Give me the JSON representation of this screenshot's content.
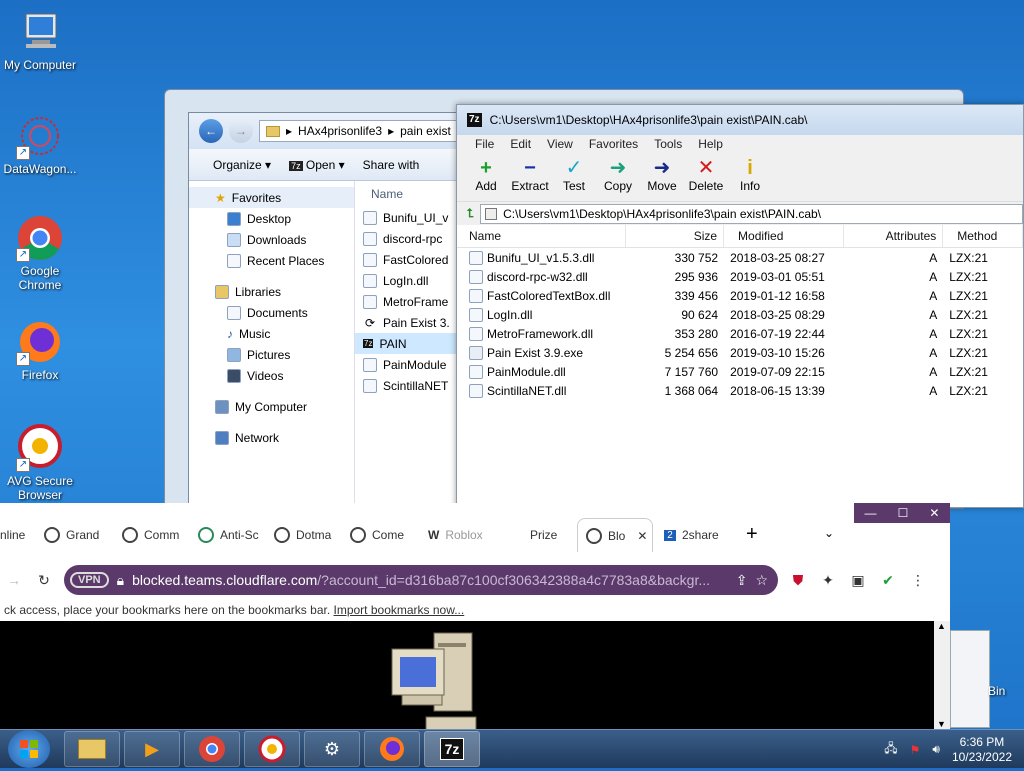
{
  "desktop": {
    "icons": [
      {
        "label": "My Computer",
        "icon": "computer-icon"
      },
      {
        "label": "DataWagon...",
        "icon": "datawagon-icon"
      },
      {
        "label": "Google Chrome",
        "icon": "chrome-icon"
      },
      {
        "label": "Firefox",
        "icon": "firefox-icon"
      },
      {
        "label": "AVG Secure Browser",
        "icon": "avg-browser-icon"
      }
    ],
    "recycle_bin_label": "Bin"
  },
  "explorer": {
    "path": [
      "HAx4prisonlife3",
      "pain exist"
    ],
    "toolbar": {
      "organize": "Organize",
      "open": "Open",
      "share": "Share with"
    },
    "nav": {
      "favorites": "Favorites",
      "favorites_items": [
        "Desktop",
        "Downloads",
        "Recent Places"
      ],
      "libraries": "Libraries",
      "libraries_items": [
        "Documents",
        "Music",
        "Pictures",
        "Videos"
      ],
      "my_computer": "My Computer",
      "network": "Network"
    },
    "column_name": "Name",
    "files": [
      "Bunifu_UI_v",
      "discord-rpc",
      "FastColored",
      "LogIn.dll",
      "MetroFrame",
      "Pain Exist 3.",
      "PAIN",
      "PainModule",
      "ScintillaNET"
    ]
  },
  "sevenzip": {
    "title": "C:\\Users\\vm1\\Desktop\\HAx4prisonlife3\\pain exist\\PAIN.cab\\",
    "logo": "7z",
    "menu": [
      "File",
      "Edit",
      "View",
      "Favorites",
      "Tools",
      "Help"
    ],
    "tools": [
      {
        "label": "Add",
        "glyph": "+",
        "color": "#1e9e2e"
      },
      {
        "label": "Extract",
        "glyph": "−",
        "color": "#1b2fa8"
      },
      {
        "label": "Test",
        "glyph": "✓",
        "color": "#19a6c9"
      },
      {
        "label": "Copy",
        "glyph": "➜",
        "color": "#1aa07a"
      },
      {
        "label": "Move",
        "glyph": "➜",
        "color": "#1a2a8a"
      },
      {
        "label": "Delete",
        "glyph": "✕",
        "color": "#d21a1a"
      },
      {
        "label": "Info",
        "glyph": "i",
        "color": "#d8a800"
      }
    ],
    "address": "C:\\Users\\vm1\\Desktop\\HAx4prisonlife3\\pain exist\\PAIN.cab\\",
    "columns": {
      "name": "Name",
      "size": "Size",
      "modified": "Modified",
      "attributes": "Attributes",
      "method": "Method"
    },
    "rows": [
      {
        "name": "Bunifu_UI_v1.5.3.dll",
        "size": "330 752",
        "modified": "2018-03-25 08:27",
        "attr": "A",
        "method": "LZX:21"
      },
      {
        "name": "discord-rpc-w32.dll",
        "size": "295 936",
        "modified": "2019-03-01 05:51",
        "attr": "A",
        "method": "LZX:21"
      },
      {
        "name": "FastColoredTextBox.dll",
        "size": "339 456",
        "modified": "2019-01-12 16:58",
        "attr": "A",
        "method": "LZX:21"
      },
      {
        "name": "LogIn.dll",
        "size": "90 624",
        "modified": "2018-03-25 08:29",
        "attr": "A",
        "method": "LZX:21"
      },
      {
        "name": "MetroFramework.dll",
        "size": "353 280",
        "modified": "2016-07-19 22:44",
        "attr": "A",
        "method": "LZX:21"
      },
      {
        "name": "Pain Exist 3.9.exe",
        "size": "5 254 656",
        "modified": "2019-03-10 15:26",
        "attr": "A",
        "method": "LZX:21"
      },
      {
        "name": "PainModule.dll",
        "size": "7 157 760",
        "modified": "2019-07-09 22:15",
        "attr": "A",
        "method": "LZX:21"
      },
      {
        "name": "ScintillaNET.dll",
        "size": "1 368 064",
        "modified": "2018-06-15 13:39",
        "attr": "A",
        "method": "LZX:21"
      }
    ]
  },
  "browser": {
    "tabs": [
      "nline",
      "Grand",
      "Comm",
      "Anti-Sc",
      "Dotma",
      "Come",
      "Roblox",
      "Prize",
      "Blo",
      "2share"
    ],
    "url_host": "blocked.teams.cloudflare.com",
    "url_rest": "/?account_id=d316ba87c100cf306342388a4c7783a8&backgr...",
    "vpn_badge": "VPN",
    "bookmarks_text": "ck access, place your bookmarks here on the bookmarks bar.",
    "bookmarks_link": "Import bookmarks now...",
    "accent": "#5b3a6b"
  },
  "taskbar": {
    "time": "6:36 PM",
    "date": "10/23/2022",
    "seven_zip": "7z"
  }
}
